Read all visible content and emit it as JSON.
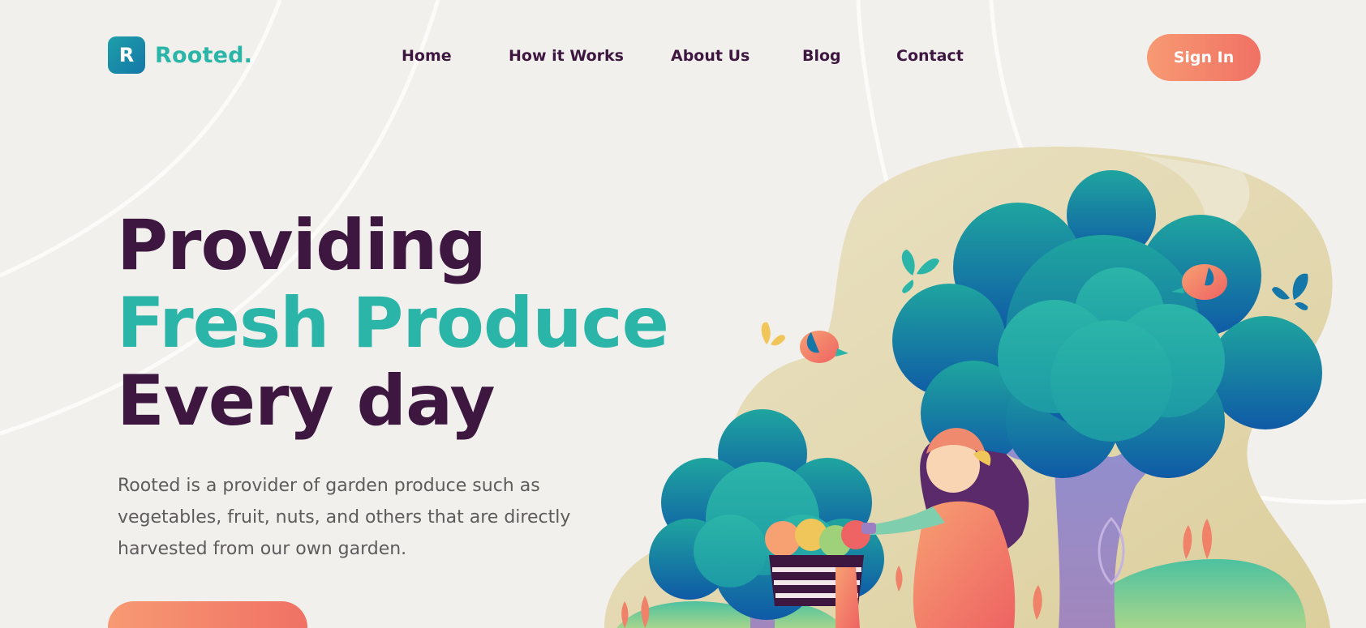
{
  "brand": {
    "logo_letter": "R",
    "name": "Rooted."
  },
  "nav": {
    "items": [
      {
        "label": "Home"
      },
      {
        "label": "How it Works"
      },
      {
        "label": "About Us"
      },
      {
        "label": "Blog"
      },
      {
        "label": "Contact"
      }
    ],
    "signin_label": "Sign In"
  },
  "hero": {
    "title_line1": "Providing",
    "title_line2": "Fresh Produce",
    "title_line3": "Every day",
    "description": "Rooted is a provider of garden produce such as vegetables, fruit, nuts, and others that are directly harvested from our own garden."
  },
  "colors": {
    "background": "#f2f0ec",
    "brand_teal": "#2bb5a8",
    "dark_purple": "#3d1740",
    "accent_coral": "#f07164",
    "body_text": "#5f5a5c"
  }
}
